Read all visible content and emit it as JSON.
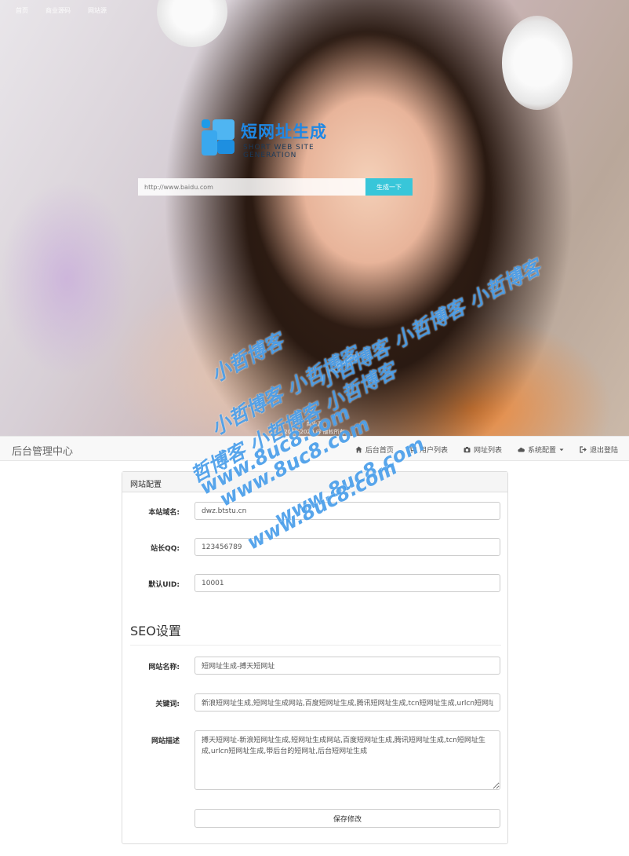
{
  "hero": {
    "nav": [
      "首页",
      "商业源码",
      "网站源"
    ],
    "logo_title": "短网址生成",
    "logo_subtitle": "SHORT WEB SITE GENERATION",
    "search_placeholder": "http://www.baidu.com",
    "search_button": "生成一下",
    "footer_line1": "商业源",
    "footer_line2": "2019-2020 @ 版权所有"
  },
  "navbar": {
    "brand": "后台管理中心",
    "links": [
      {
        "label": "后台首页",
        "icon": "home-icon"
      },
      {
        "label": "用户列表",
        "icon": "cart-icon"
      },
      {
        "label": "网址列表",
        "icon": "camera-icon"
      },
      {
        "label": "系统配置",
        "icon": "cloud-icon"
      },
      {
        "label": "退出登陆",
        "icon": "logout-icon"
      }
    ]
  },
  "panel": {
    "heading": "网站配置",
    "site_domain_label": "本站域名:",
    "site_domain_value": "dwz.btstu.cn",
    "qq_label": "站长QQ:",
    "qq_value": "123456789",
    "uid_label": "默认UID:",
    "uid_value": "10001",
    "seo_title": "SEO设置",
    "site_name_label": "网站名称:",
    "site_name_value": "短网址生成-搏天短网址",
    "keywords_label": "关键词:",
    "keywords_value": "新浪短网址生成,短网址生成网站,百度短网址生成,腾讯短网址生成,tcn短网址生成,urlcn短网址生成",
    "description_label": "网站描述",
    "description_value": "搏天短网址-新浪短网址生成,短网址生成网站,百度短网址生成,腾讯短网址生成,tcn短网址生成,urlcn短网址生成,带后台的短网址,后台短网址生成",
    "save_button": "保存修改"
  },
  "watermark": {
    "lines": [
      "小哲博客",
      "小哲博客 小哲博客",
      "小哲博客 小哲博客 小哲博客",
      "哲博客 小哲博客 小哲博客",
      "www.8uc8.com",
      "www.8uc8.com",
      "www.8uc8.com",
      "www.8uc8.com"
    ]
  },
  "colors": {
    "accent": "#38c6d9",
    "logo_blue": "#1e88e5",
    "watermark_blue": "#288ce6"
  }
}
